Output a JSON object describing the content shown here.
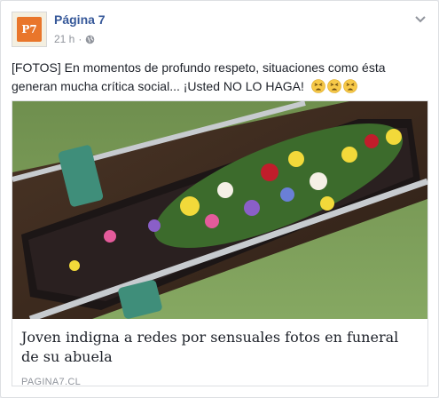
{
  "post": {
    "page_name": "Página 7",
    "avatar_text": "P7",
    "timestamp": "21 h",
    "separator": "·",
    "privacy_icon": "globe-icon",
    "menu_icon": "chevron-down-icon",
    "body_text": "[FOTOS] En momentos de profundo respeto, situaciones como ésta generan mucha crítica social... ¡Usted NO LO HAGA!",
    "emojis": [
      "tired-face-icon",
      "tired-face-icon",
      "tired-face-icon"
    ]
  },
  "link_preview": {
    "image_description": "photo-of-flower-covered-coffin-in-grave",
    "title": "Joven indigna a redes por sensuales fotos en funeral de su abuela",
    "domain": "PAGINA7.CL"
  },
  "colors": {
    "link_blue": "#365899",
    "meta_gray": "#90949c",
    "text": "#1d2129",
    "border": "#dddfe2",
    "avatar_orange": "#e9762b"
  }
}
